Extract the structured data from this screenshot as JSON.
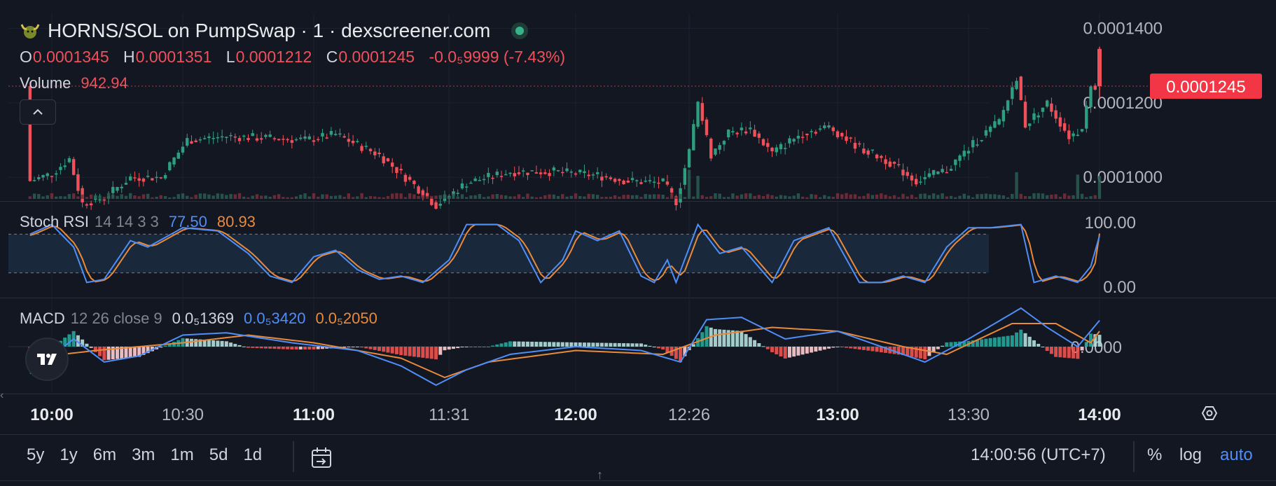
{
  "header": {
    "title": "HORNS/SOL on PumpSwap · 1 · dexscreener.com",
    "ohlc": {
      "o_label": "O",
      "o": "0.0001345",
      "h_label": "H",
      "h": "0.0001351",
      "l_label": "L",
      "l": "0.0001212",
      "c_label": "C",
      "c": "0.0001245",
      "change": "-0.0₅9999 (-7.43%)"
    },
    "volume_label": "Volume",
    "volume_value": "942.94",
    "collapse_icon": "chevron-up-icon"
  },
  "price_axis": {
    "ticks": [
      "0.0001400",
      "0.0001200",
      "0.0001000"
    ],
    "last_price": "0.0001245"
  },
  "stoch_rsi": {
    "label": "Stoch RSI",
    "params": "14 14 3 3",
    "k": "77.50",
    "d": "80.93",
    "ticks": [
      "100.00",
      "0.00"
    ]
  },
  "macd": {
    "label": "MACD",
    "params": "12 26 close 9",
    "hist": "0.0₅1369",
    "macd": "0.0₅3420",
    "signal": "0.0₅2050",
    "ticks": [
      "0.0000"
    ]
  },
  "time_axis": {
    "labels": [
      {
        "text": "10:00",
        "bold": true
      },
      {
        "text": "10:30",
        "bold": false
      },
      {
        "text": "11:00",
        "bold": true
      },
      {
        "text": "11:31",
        "bold": false
      },
      {
        "text": "12:00",
        "bold": true
      },
      {
        "text": "12:26",
        "bold": false
      },
      {
        "text": "13:00",
        "bold": true
      },
      {
        "text": "13:30",
        "bold": false
      },
      {
        "text": "14:00",
        "bold": true
      }
    ]
  },
  "toolbar": {
    "ranges": [
      "5y",
      "1y",
      "6m",
      "3m",
      "1m",
      "5d",
      "1d"
    ],
    "clock": "14:00:56 (UTC+7)",
    "percent": "%",
    "log": "log",
    "auto": "auto",
    "calendar_icon": "calendar-goto-icon",
    "settings_icon": "settings-hexagon-icon"
  },
  "colors": {
    "background": "#131722",
    "up": "#2f9e80",
    "down": "#f0505a",
    "stoch_k": "#4f8ef7",
    "stoch_d": "#e88a3a",
    "macd_line": "#4f8ef7",
    "signal_line": "#e88a3a"
  },
  "chart_data": {
    "type": "candlestick",
    "title": "HORNS/SOL on PumpSwap · 1 · dexscreener.com",
    "x_time_labels": [
      "10:00",
      "10:30",
      "11:00",
      "11:31",
      "12:00",
      "12:26",
      "13:00",
      "13:30",
      "14:00"
    ],
    "ylim": [
      9.4e-05,
      0.000142
    ],
    "price_path": [
      [
        "09:55",
        9.9e-05
      ],
      [
        "10:00",
        0.000101
      ],
      [
        "10:04",
        0.000105
      ],
      [
        "10:07",
        9.3e-05
      ],
      [
        "10:12",
        9.45e-05
      ],
      [
        "10:18",
        0.0001
      ],
      [
        "10:25",
        0.0001
      ],
      [
        "10:31",
        0.00011
      ],
      [
        "10:40",
        0.000111
      ],
      [
        "10:50",
        0.0001105
      ],
      [
        "10:58",
        0.00011
      ],
      [
        "11:05",
        0.0001115
      ],
      [
        "11:15",
        0.000106
      ],
      [
        "11:22",
        9.9e-05
      ],
      [
        "11:28",
        9.25e-05
      ],
      [
        "11:35",
        9.85e-05
      ],
      [
        "11:45",
        0.0001015
      ],
      [
        "11:55",
        0.0001015
      ],
      [
        "12:05",
        0.0001005
      ],
      [
        "12:12",
        9.9e-05
      ],
      [
        "12:20",
        9.85e-05
      ],
      [
        "12:23",
        9.35e-05
      ],
      [
        "12:26",
        0.000107
      ],
      [
        "12:28",
        0.00012
      ],
      [
        "12:31",
        0.000106
      ],
      [
        "12:35",
        0.000112
      ],
      [
        "12:40",
        0.000113
      ],
      [
        "12:45",
        0.0001065
      ],
      [
        "12:52",
        0.000112
      ],
      [
        "12:58",
        0.0001135
      ],
      [
        "13:05",
        0.000108
      ],
      [
        "13:12",
        0.000104
      ],
      [
        "13:18",
        9.9e-05
      ],
      [
        "13:25",
        0.000102
      ],
      [
        "13:32",
        0.00011
      ],
      [
        "13:37",
        0.000115
      ],
      [
        "13:41",
        0.000127
      ],
      [
        "13:43",
        0.000114
      ],
      [
        "13:48",
        0.00012
      ],
      [
        "13:53",
        0.000111
      ],
      [
        "13:56",
        0.000113
      ],
      [
        "13:58",
        0.000125
      ],
      [
        "14:00",
        0.0001245
      ]
    ],
    "ohlc_last": {
      "open": 0.0001345,
      "high": 0.0001351,
      "low": 0.0001212,
      "close": 0.0001245
    },
    "volume_last": 942.94,
    "volume_spikes": [
      [
        "12:26",
        1200
      ],
      [
        "12:28",
        950
      ],
      [
        "13:41",
        1100
      ],
      [
        "13:55",
        1000
      ],
      [
        "14:00",
        942.94
      ]
    ],
    "stoch_rsi": {
      "k_last": 77.5,
      "d_last": 80.93,
      "range": [
        0,
        100
      ],
      "bands": [
        80,
        20
      ],
      "k_path": [
        [
          "09:55",
          80
        ],
        [
          "10:00",
          95
        ],
        [
          "10:05",
          60
        ],
        [
          "10:08",
          5
        ],
        [
          "10:12",
          10
        ],
        [
          "10:18",
          70
        ],
        [
          "10:22",
          60
        ],
        [
          "10:30",
          90
        ],
        [
          "10:38",
          85
        ],
        [
          "10:45",
          50
        ],
        [
          "10:50",
          15
        ],
        [
          "10:55",
          5
        ],
        [
          "11:00",
          45
        ],
        [
          "11:05",
          55
        ],
        [
          "11:10",
          25
        ],
        [
          "11:15",
          10
        ],
        [
          "11:20",
          15
        ],
        [
          "11:25",
          5
        ],
        [
          "11:31",
          40
        ],
        [
          "11:35",
          95
        ],
        [
          "11:42",
          95
        ],
        [
          "11:47",
          70
        ],
        [
          "11:52",
          5
        ],
        [
          "11:57",
          40
        ],
        [
          "12:00",
          85
        ],
        [
          "12:05",
          70
        ],
        [
          "12:10",
          85
        ],
        [
          "12:15",
          15
        ],
        [
          "12:18",
          5
        ],
        [
          "12:21",
          40
        ],
        [
          "12:23",
          5
        ],
        [
          "12:28",
          95
        ],
        [
          "12:33",
          50
        ],
        [
          "12:38",
          60
        ],
        [
          "12:45",
          5
        ],
        [
          "12:50",
          70
        ],
        [
          "12:58",
          90
        ],
        [
          "13:05",
          5
        ],
        [
          "13:10",
          5
        ],
        [
          "13:15",
          15
        ],
        [
          "13:20",
          5
        ],
        [
          "13:25",
          60
        ],
        [
          "13:30",
          90
        ],
        [
          "13:35",
          90
        ],
        [
          "13:42",
          95
        ],
        [
          "13:45",
          5
        ],
        [
          "13:50",
          15
        ],
        [
          "13:55",
          5
        ],
        [
          "13:58",
          30
        ],
        [
          "14:00",
          77.5
        ]
      ]
    },
    "macd": {
      "hist_last": 1.369e-06,
      "macd_last": 3.42e-06,
      "signal_last": 2.05e-06,
      "macd_path": [
        [
          "09:55",
          -3.5
        ],
        [
          "10:05",
          1.0
        ],
        [
          "10:12",
          -2.0
        ],
        [
          "10:20",
          -1.2
        ],
        [
          "10:30",
          1.5
        ],
        [
          "10:40",
          1.8
        ],
        [
          "10:55",
          0.5
        ],
        [
          "11:10",
          -0.5
        ],
        [
          "11:20",
          -2.5
        ],
        [
          "11:28",
          -5.0
        ],
        [
          "11:35",
          -3.0
        ],
        [
          "11:45",
          -1.0
        ],
        [
          "12:00",
          0.0
        ],
        [
          "12:15",
          -0.5
        ],
        [
          "12:24",
          -2.0
        ],
        [
          "12:30",
          3.5
        ],
        [
          "12:38",
          3.8
        ],
        [
          "12:48",
          1.0
        ],
        [
          "13:00",
          2.0
        ],
        [
          "13:10",
          0.0
        ],
        [
          "13:20",
          -2.0
        ],
        [
          "13:30",
          1.0
        ],
        [
          "13:42",
          5.0
        ],
        [
          "13:48",
          2.5
        ],
        [
          "13:55",
          0.0
        ],
        [
          "14:00",
          3.4
        ]
      ],
      "signal_path": [
        [
          "09:55",
          -1.5
        ],
        [
          "10:10",
          -0.5
        ],
        [
          "10:30",
          0.5
        ],
        [
          "10:45",
          1.5
        ],
        [
          "11:00",
          0.5
        ],
        [
          "11:20",
          -1.5
        ],
        [
          "11:30",
          -4.0
        ],
        [
          "11:40",
          -2.0
        ],
        [
          "12:00",
          -0.5
        ],
        [
          "12:20",
          -1.0
        ],
        [
          "12:32",
          1.5
        ],
        [
          "12:45",
          2.5
        ],
        [
          "13:00",
          2.0
        ],
        [
          "13:15",
          0.0
        ],
        [
          "13:25",
          -1.0
        ],
        [
          "13:40",
          3.0
        ],
        [
          "13:50",
          3.0
        ],
        [
          "13:58",
          0.5
        ],
        [
          "14:00",
          2.0
        ]
      ]
    }
  }
}
